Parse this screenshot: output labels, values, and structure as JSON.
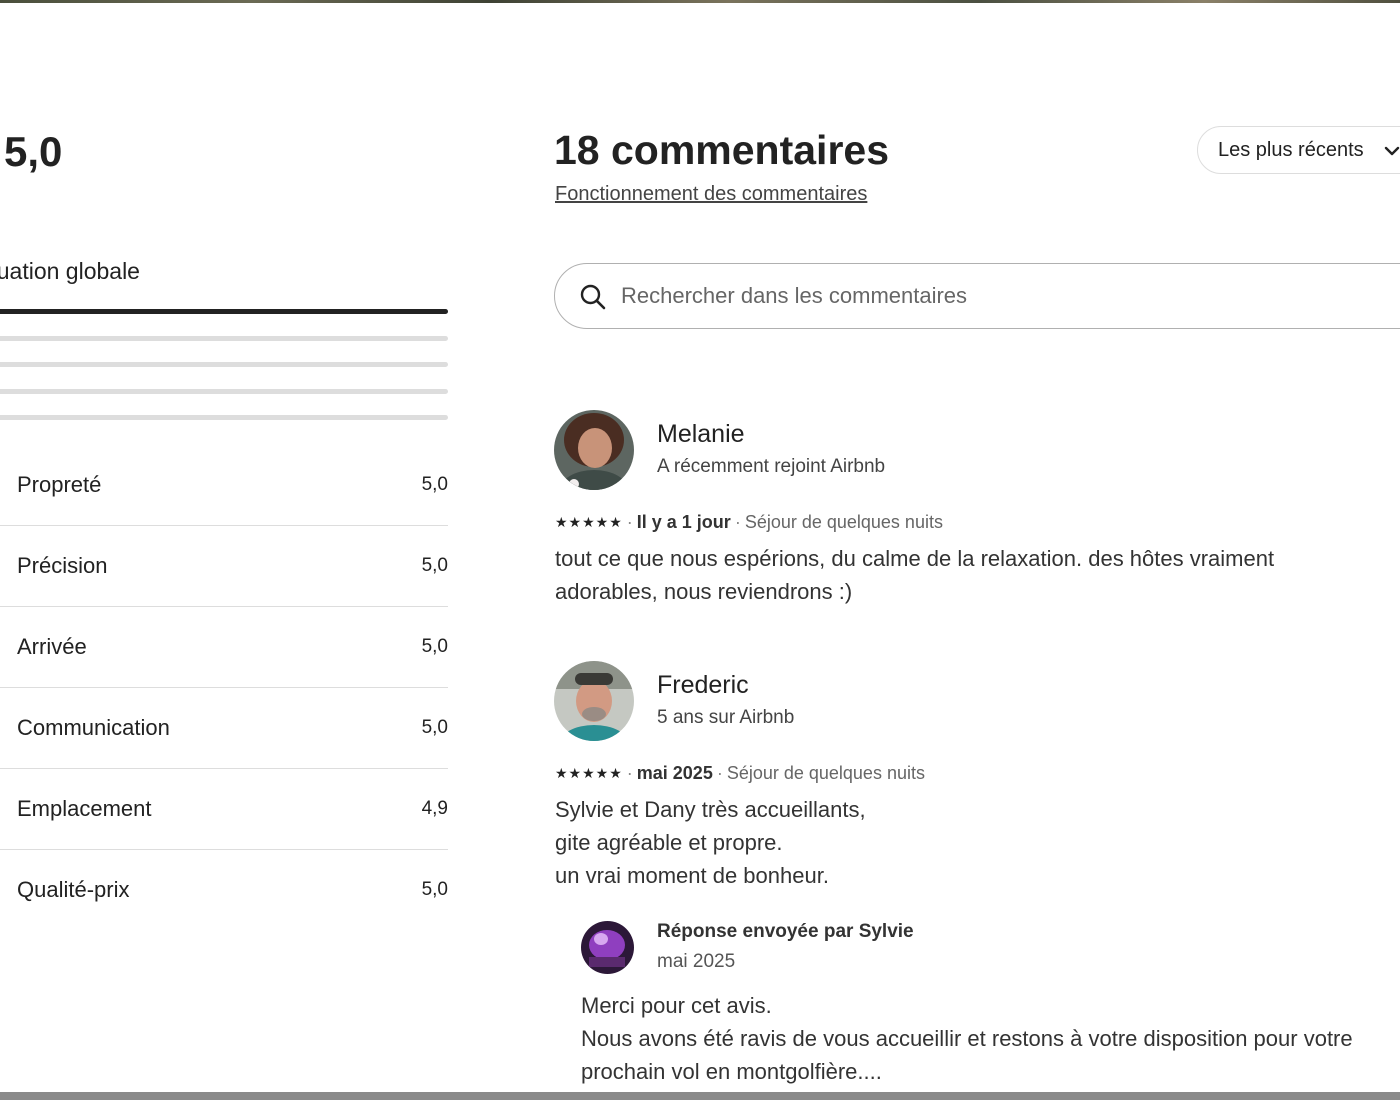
{
  "rating_summary": {
    "overall_score": "5,0",
    "overall_label": "Évaluation globale",
    "distribution": [
      {
        "stars": 5,
        "fraction": 1.0
      },
      {
        "stars": 4,
        "fraction": 0.0
      },
      {
        "stars": 3,
        "fraction": 0.0
      },
      {
        "stars": 2,
        "fraction": 0.0
      },
      {
        "stars": 1,
        "fraction": 0.0
      }
    ],
    "categories": [
      {
        "label": "Propreté",
        "value": "5,0"
      },
      {
        "label": "Précision",
        "value": "5,0"
      },
      {
        "label": "Arrivée",
        "value": "5,0"
      },
      {
        "label": "Communication",
        "value": "5,0"
      },
      {
        "label": "Emplacement",
        "value": "4,9"
      },
      {
        "label": "Qualité-prix",
        "value": "5,0"
      }
    ]
  },
  "reviews_header": {
    "title": "18 commentaires",
    "how_it_works_link": "Fonctionnement des commentaires",
    "sort_label": "Les plus récents",
    "sort_icon": "chevron-down-icon"
  },
  "search": {
    "placeholder": "Rechercher dans les commentaires",
    "value": "",
    "icon": "search-icon"
  },
  "reviews": [
    {
      "name": "Melanie",
      "meta": "A récemment rejoint Airbnb",
      "stars": "★★★★★",
      "date": "Il y a 1 jour",
      "stay": "Séjour de quelques nuits",
      "text_lines": [
        "tout ce que nous espérions, du calme de la relaxation.  des hôtes vraiment",
        "adorables, nous reviendrons :)"
      ]
    },
    {
      "name": "Frederic",
      "meta": "5 ans sur Airbnb",
      "stars": "★★★★★",
      "date": "mai 2025",
      "stay": "Séjour de quelques nuits",
      "text_lines": [
        "Sylvie et Dany très accueillants,",
        "gite agréable et propre.",
        "un vrai moment de bonheur."
      ],
      "reply": {
        "title": "Réponse envoyée par Sylvie",
        "date": "mai 2025",
        "text_lines": [
          "Merci pour cet avis.",
          "Nous avons été ravis de vous accueillir et restons à votre disposition pour votre",
          "prochain vol en montgolfière...."
        ]
      }
    }
  ],
  "colors": {
    "text": "#222222",
    "muted": "#666666",
    "divider": "#dddddd",
    "bar_fill": "#222222",
    "bar_track": "#dddddd"
  }
}
